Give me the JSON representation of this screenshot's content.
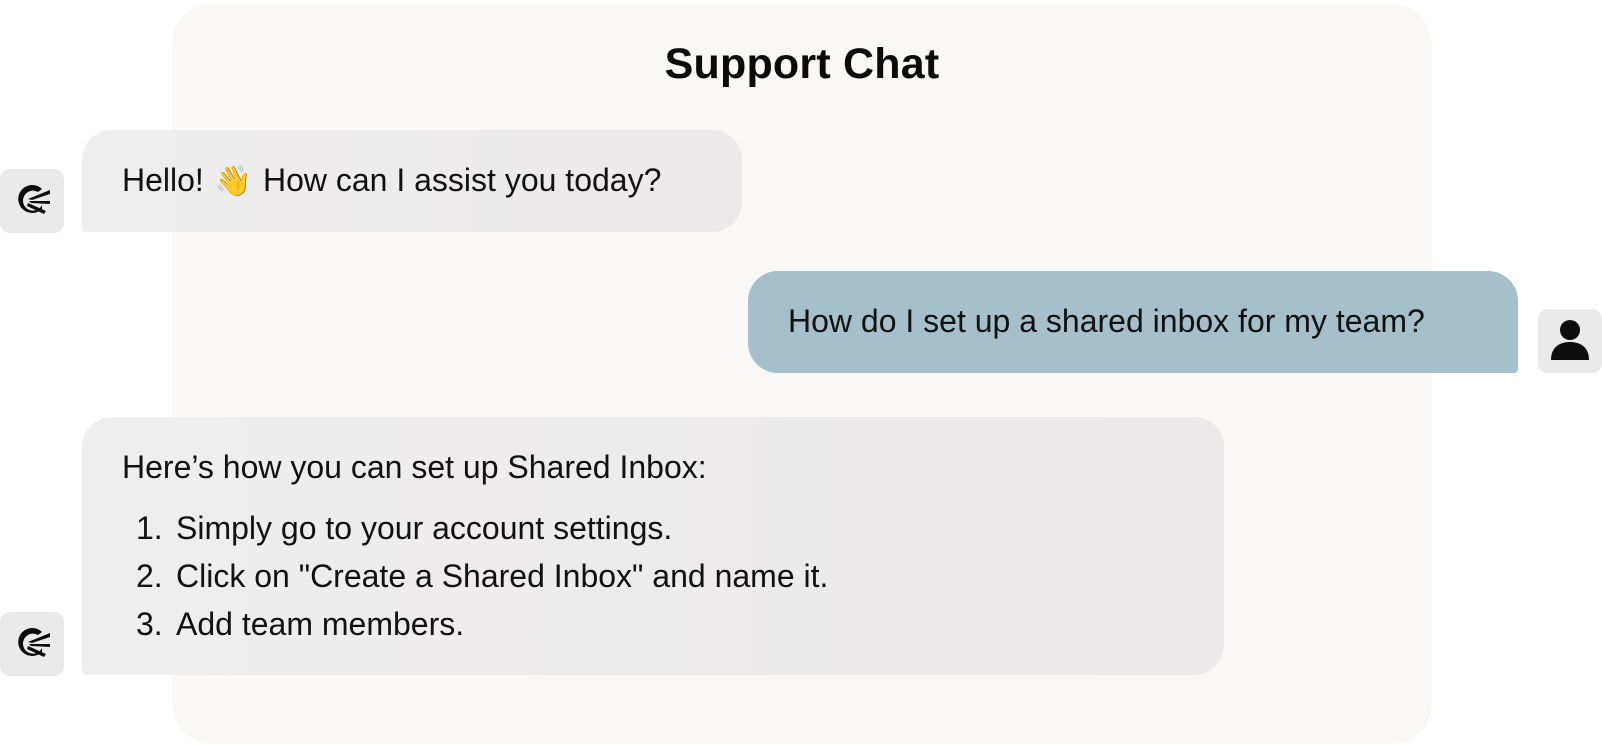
{
  "chat": {
    "title": "Support Chat",
    "messages": [
      {
        "sender": "bot",
        "text_before": "Hello!",
        "emoji": "👋",
        "text_after": "How can I assist you today?"
      },
      {
        "sender": "user",
        "text": "How do I set up a shared inbox for my team?"
      },
      {
        "sender": "bot",
        "intro": "Here’s how you can set up Shared Inbox:",
        "steps": [
          {
            "num": "1.",
            "text": "Simply go to your account settings."
          },
          {
            "num": "2.",
            "text": "Click on \"Create a Shared Inbox\" and name it."
          },
          {
            "num": "3.",
            "text": "Add team members."
          }
        ]
      }
    ]
  },
  "icons": {
    "bot_avatar": "bird-logo-icon",
    "user_avatar": "user-person-icon"
  },
  "colors": {
    "panel_bg": "#f9f8f7",
    "bot_bubble": "#ecebeb",
    "user_bubble": "#a5bfcb",
    "avatar_bg": "#ebeaea",
    "text": "#111111"
  }
}
